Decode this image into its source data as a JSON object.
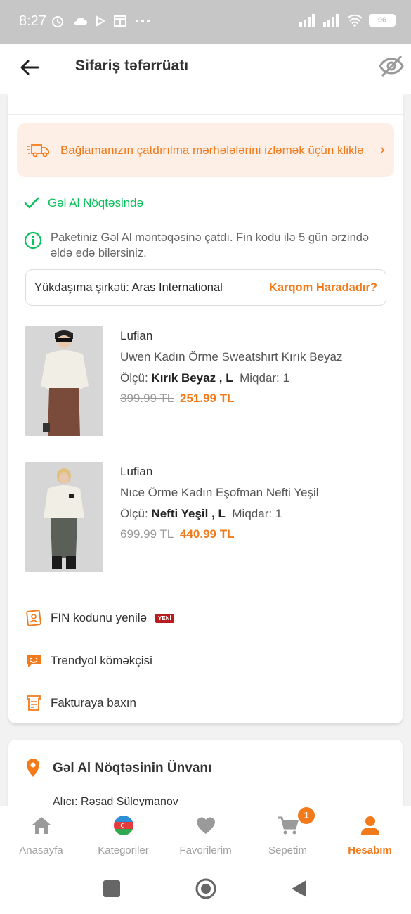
{
  "status_bar": {
    "time": "8:27",
    "battery": "96"
  },
  "header": {
    "title": "Sifariş təfərrüatı"
  },
  "tracking_banner": {
    "text": "Bağlamanızın çatdırılma mərhələlərini izləmək üçün kliklə"
  },
  "delivery_status": {
    "label": "Gəl Al Nöqtəsində",
    "info": "Paketiniz Gəl Al məntəqəsinə çatdı. Fin kodu ilə 5 gün ərzində əldə edə bilərsiniz."
  },
  "cargo": {
    "label": "Yükdaşıma şirkəti:",
    "company": "Aras International",
    "link": "Karqom Haradadır?"
  },
  "products": [
    {
      "brand": "Lufian",
      "name": "Uwen Kadın Örme Sweatshırt Kırık Beyaz",
      "size_label": "Ölçü:",
      "size_value": "Kırık Beyaz , L",
      "qty_label": "Miqdar:",
      "qty_value": "1",
      "old_price": "399.99 TL",
      "new_price": "251.99 TL"
    },
    {
      "brand": "Lufian",
      "name": "Nıce Örme Kadın Eşofman Nefti Yeşil",
      "size_label": "Ölçü:",
      "size_value": "Nefti Yeşil , L",
      "qty_label": "Miqdar:",
      "qty_value": "1",
      "old_price": "699.99 TL",
      "new_price": "440.99 TL"
    }
  ],
  "actions": {
    "fin": "FIN kodunu yenilə",
    "fin_badge": "YENİ",
    "assistant": "Trendyol köməkçisi",
    "invoice": "Fakturaya baxın"
  },
  "address_card": {
    "title": "Gəl Al Nöqtəsinin Ünvanı",
    "recipient": "Alıcı: Rəşad Süleymanov"
  },
  "bottom_nav": {
    "home": "Anasayfa",
    "categories": "Kategoriler",
    "favorites": "Favorilerim",
    "cart": "Sepetim",
    "cart_count": "1",
    "account": "Hesabım"
  },
  "colors": {
    "accent": "#f27a1a",
    "success": "#0bc15c",
    "banner_bg": "#fdeee6"
  }
}
